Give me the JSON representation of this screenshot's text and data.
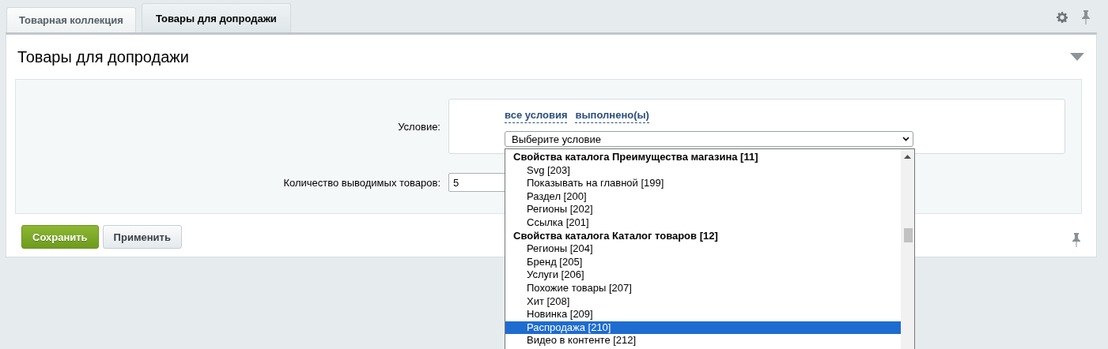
{
  "tabs": [
    {
      "label": "Товарная коллекция",
      "selected": false
    },
    {
      "label": "Товары для допродажи",
      "selected": true
    }
  ],
  "section": {
    "title": "Товары для допродажи",
    "expanded": true
  },
  "condition": {
    "label": "Условие:",
    "links": [
      "все условия",
      "выполнено(ы)"
    ],
    "select": {
      "value": "Выберите условие",
      "open": true,
      "options": [
        {
          "kind": "group",
          "label": "Свойства каталога Преимущества магазина [11]",
          "selected": false
        },
        {
          "kind": "option",
          "label": "Svg [203]",
          "selected": false
        },
        {
          "kind": "option",
          "label": "Показывать на главной [199]",
          "selected": false
        },
        {
          "kind": "option",
          "label": "Раздел [200]",
          "selected": false
        },
        {
          "kind": "option",
          "label": "Регионы [202]",
          "selected": false
        },
        {
          "kind": "option",
          "label": "Ссылка [201]",
          "selected": false
        },
        {
          "kind": "group",
          "label": "Свойства каталога Каталог товаров [12]",
          "selected": false
        },
        {
          "kind": "option",
          "label": "Регионы [204]",
          "selected": false
        },
        {
          "kind": "option",
          "label": "Бренд [205]",
          "selected": false
        },
        {
          "kind": "option",
          "label": "Услуги [206]",
          "selected": false
        },
        {
          "kind": "option",
          "label": "Похожие товары [207]",
          "selected": false
        },
        {
          "kind": "option",
          "label": "Хит [208]",
          "selected": false
        },
        {
          "kind": "option",
          "label": "Новинка [209]",
          "selected": false
        },
        {
          "kind": "option",
          "label": "Распродажа [210]",
          "selected": true
        },
        {
          "kind": "option",
          "label": "Видео в контенте [212]",
          "selected": false
        }
      ]
    }
  },
  "quantity": {
    "label": "Количество выводимых товаров:",
    "value": "5"
  },
  "buttons": [
    {
      "label": "Сохранить",
      "kind": "primary"
    },
    {
      "label": "Применить",
      "kind": "secondary"
    }
  ]
}
